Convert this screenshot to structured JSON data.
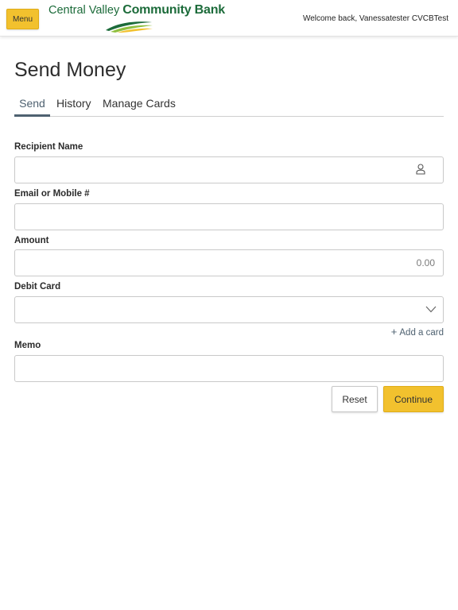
{
  "header": {
    "menu_label": "Menu",
    "logo_light": "Central Valley ",
    "logo_bold": "Community Bank",
    "welcome": "Welcome back, Vanessatester CVCBTest"
  },
  "page": {
    "title": "Send Money"
  },
  "tabs": [
    {
      "label": "Send",
      "active": true
    },
    {
      "label": "History",
      "active": false
    },
    {
      "label": "Manage Cards",
      "active": false
    }
  ],
  "form": {
    "recipient": {
      "label": "Recipient Name",
      "value": "",
      "icon": "person-icon"
    },
    "contact": {
      "label": "Email or Mobile #",
      "value": ""
    },
    "amount": {
      "label": "Amount",
      "value": "",
      "placeholder": "0.00"
    },
    "debit_card": {
      "label": "Debit Card",
      "selected": "",
      "icon": "chevron-down-icon"
    },
    "add_card": "Add a card",
    "memo": {
      "label": "Memo",
      "value": ""
    }
  },
  "actions": {
    "reset": "Reset",
    "continue": "Continue"
  },
  "colors": {
    "accent": "#f2c12e",
    "tab_active": "#4e6170",
    "brand_green": "#1c6b3a"
  }
}
